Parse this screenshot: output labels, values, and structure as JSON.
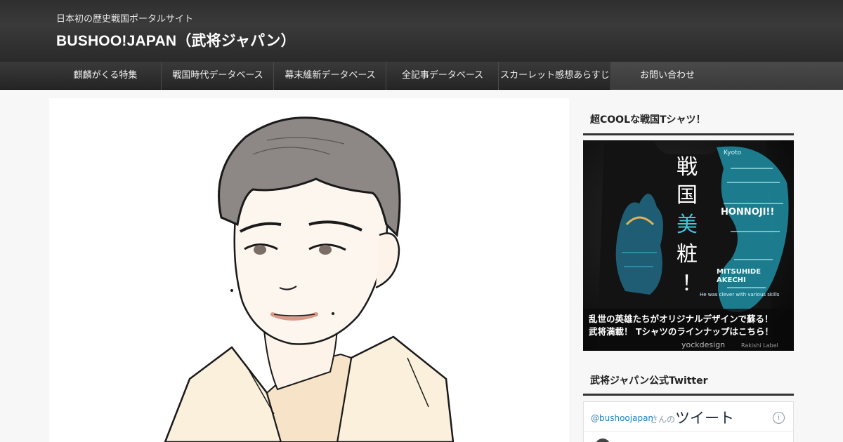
{
  "header": {
    "tagline": "日本初の歴史戦国ポータルサイト",
    "site_title": "BUSHOO!JAPAN（武将ジャパン）"
  },
  "nav": {
    "items": [
      {
        "label": "麒麟がくる特集"
      },
      {
        "label": "戦国時代データベース"
      },
      {
        "label": "幕末維新データベース"
      },
      {
        "label": "全記事データベース"
      },
      {
        "label": "スカーレット感想あらすじ"
      },
      {
        "label": "お問い合わせ"
      }
    ]
  },
  "sidebar": {
    "shirt_widget": {
      "title": "超COOLな戦国Tシャツ！",
      "ad": {
        "vertical_text": [
          "戦",
          "国",
          "美",
          "粧",
          "！"
        ],
        "vertical_accent_color": "#3fc8d6",
        "caption_line1": "乱世の英雄たちがオリジナルデザインで蘇る！",
        "caption_line2": "武将満載！ Tシャツのラインナップはこちら！",
        "brand": "yockdesign",
        "brand_sub": "Rakishi Label",
        "art_words": [
          "HONNOJI!!",
          "MITSUHIDE",
          "AKECHI",
          "Kyoto",
          "He was clever with various skills"
        ]
      }
    },
    "twitter_widget": {
      "title": "武将ジャパン公式Twitter",
      "handle": "@bushoojapan",
      "handle_suffix": "さんの",
      "tweets_label": "ツイート",
      "info_icon_text": "i"
    }
  },
  "colors": {
    "header_bg": "#2f2f2f",
    "nav_bg": "#2b2b2b",
    "page_bg": "#f7f7f7",
    "twitter_blue": "#1b7fc6"
  }
}
